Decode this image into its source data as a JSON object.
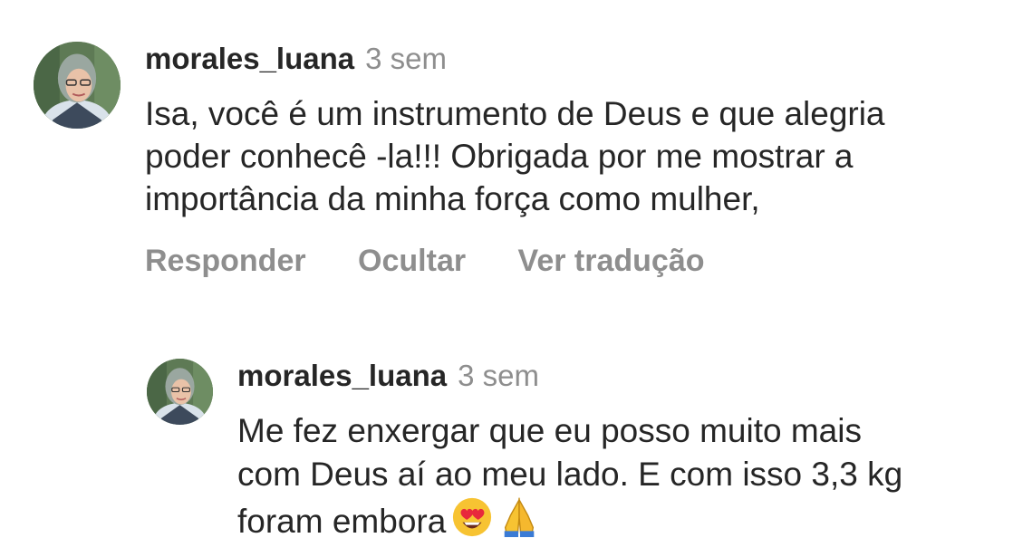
{
  "comment": {
    "username": "morales_luana",
    "time": "3 sem",
    "lines": [
      "Isa, você é um instrumento de Deus e que alegria",
      "poder conhecê -la!!! Obrigada por me mostrar a",
      "importância da minha força como mulher,"
    ],
    "actions": {
      "reply": "Responder",
      "hide": "Ocultar",
      "translate": "Ver tradução"
    }
  },
  "reply": {
    "username": "morales_luana",
    "time": "3 sem",
    "lines": [
      "Me fez enxergar que eu posso muito mais",
      "com Deus aí ao meu lado. E com isso 3,3 kg",
      "foram embora"
    ],
    "emojis": [
      "heart-eyes-emoji",
      "folded-hands-emoji"
    ]
  }
}
